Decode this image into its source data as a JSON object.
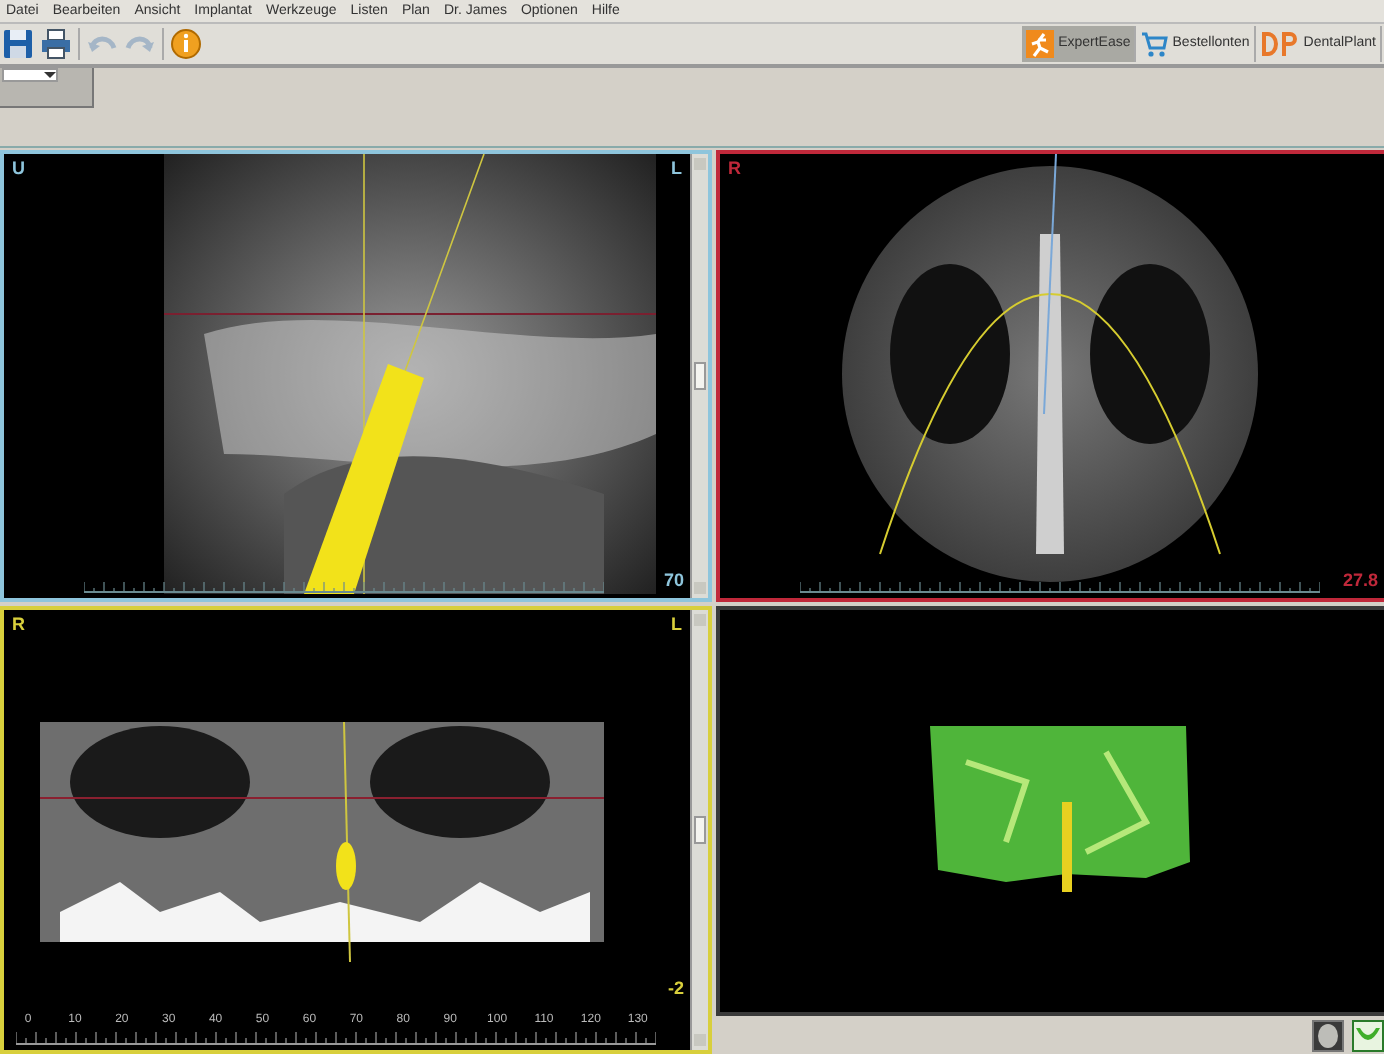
{
  "menu": [
    "Datei",
    "Bearbeiten",
    "Ansicht",
    "Implantat",
    "Werkzeuge",
    "Listen",
    "Plan",
    "Dr. James",
    "Optionen",
    "Hilfe"
  ],
  "toolbar": [
    {
      "kind": "save",
      "disabled": false
    },
    {
      "kind": "print",
      "disabled": false
    },
    {
      "kind": "undo",
      "disabled": true
    },
    {
      "kind": "redo",
      "disabled": true
    },
    {
      "kind": "info",
      "disabled": false
    }
  ],
  "tools": [
    {
      "kind": "expert",
      "label": "ExpertEase",
      "selected": true
    },
    {
      "kind": "cart",
      "label": "Bestellonten",
      "selected": false
    },
    {
      "kind": "dp",
      "label": "DentalPlant",
      "selected": false
    }
  ],
  "viewports": [
    {
      "kind": "sagittal",
      "color": "#8ec5dc",
      "label_left": "U",
      "label_right": "L",
      "reading": "70"
    },
    {
      "kind": "axial",
      "color": "#c0283a",
      "label_left": "R",
      "reading": "27.8"
    },
    {
      "kind": "panoramic",
      "color": "#d8cf3c",
      "label_left": "R",
      "label_right": "L",
      "reading": "-2",
      "ruler": [
        "0",
        "10",
        "20",
        "30",
        "40",
        "50",
        "60",
        "70",
        "80",
        "90",
        "100",
        "110",
        "120",
        "130"
      ]
    },
    {
      "kind": "model3d",
      "color": "#3a3a3a"
    }
  ],
  "thumbnails": [
    {
      "kind": "skull",
      "selected": false
    },
    {
      "kind": "jaw",
      "selected": true
    }
  ]
}
